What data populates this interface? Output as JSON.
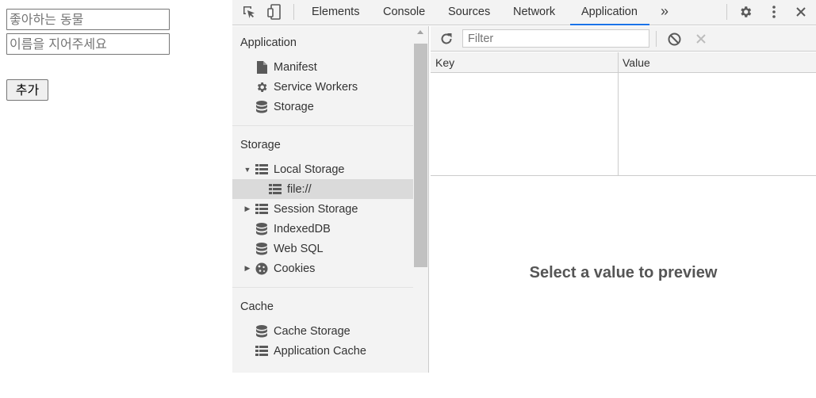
{
  "page": {
    "input1_placeholder": "좋아하는 동물",
    "input2_placeholder": "이름을 지어주세요",
    "add_button": "추가"
  },
  "devtools": {
    "tabs": [
      "Elements",
      "Console",
      "Sources",
      "Network",
      "Application"
    ],
    "active_tab": "Application",
    "more_tabs_glyph": "»",
    "sidebar": {
      "sections": {
        "application": "Application",
        "storage": "Storage",
        "cache": "Cache"
      },
      "application_items": [
        "Manifest",
        "Service Workers",
        "Storage"
      ],
      "storage_items": {
        "local_storage": "Local Storage",
        "local_storage_child": "file://",
        "session_storage": "Session Storage",
        "indexeddb": "IndexedDB",
        "web_sql": "Web SQL",
        "cookies": "Cookies"
      },
      "cache_items": [
        "Cache Storage",
        "Application Cache"
      ]
    },
    "main": {
      "filter_placeholder": "Filter",
      "columns": [
        "Key",
        "Value"
      ],
      "preview_message": "Select a value to preview"
    },
    "colors": {
      "accent": "#1a73e8",
      "panel_bg": "#f3f3f3",
      "selected_bg": "#dadada"
    }
  }
}
